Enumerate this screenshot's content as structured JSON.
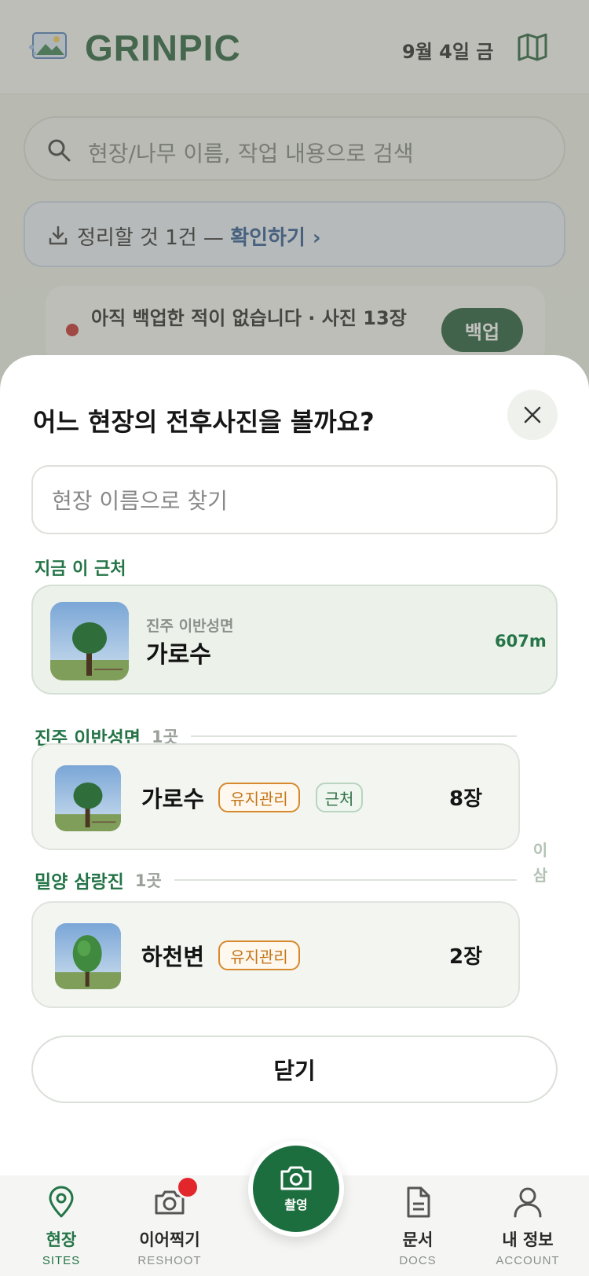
{
  "header": {
    "app_name": "GRINPIC",
    "date": "9월 4일 금"
  },
  "search": {
    "placeholder": "현장/나무 이름, 작업 내용으로 검색"
  },
  "organize_banner": {
    "text": "정리할 것 1건 —",
    "link": "확인하기 ›"
  },
  "backup_card": {
    "text": "아직 백업한 적이 없습니다 · 사진 13장",
    "button": "백업"
  },
  "sheet": {
    "title": "어느 현장의 전후사진을 볼까요?",
    "search_placeholder": "현장 이름으로 찾기",
    "nearby_label": "지금 이 근처",
    "nearby": {
      "region": "진주 이반성면",
      "name": "가로수",
      "distance": "607m"
    },
    "groups": [
      {
        "name": "진주 이반성면",
        "count": "1곳",
        "sites": [
          {
            "name": "가로수",
            "tags": [
              "유지관리",
              "근처"
            ],
            "photos": "8장"
          }
        ]
      },
      {
        "name": "밀양 삼랑진",
        "count": "1곳",
        "sites": [
          {
            "name": "하천변",
            "tags": [
              "유지관리"
            ],
            "photos": "2장"
          }
        ]
      }
    ],
    "side_index": [
      "이",
      "삼"
    ],
    "close_label": "닫기"
  },
  "nav": {
    "items": [
      {
        "label": "현장",
        "sub": "SITES"
      },
      {
        "label": "이어찍기",
        "sub": "RESHOOT"
      },
      {
        "label": "촬영"
      },
      {
        "label": "문서",
        "sub": "DOCS"
      },
      {
        "label": "내 정보",
        "sub": "ACCOUNT"
      }
    ]
  },
  "colors": {
    "brand_green": "#247447",
    "dark_green": "#17532f",
    "maint_orange": "#d6892d",
    "alert_red": "#e3262b"
  }
}
